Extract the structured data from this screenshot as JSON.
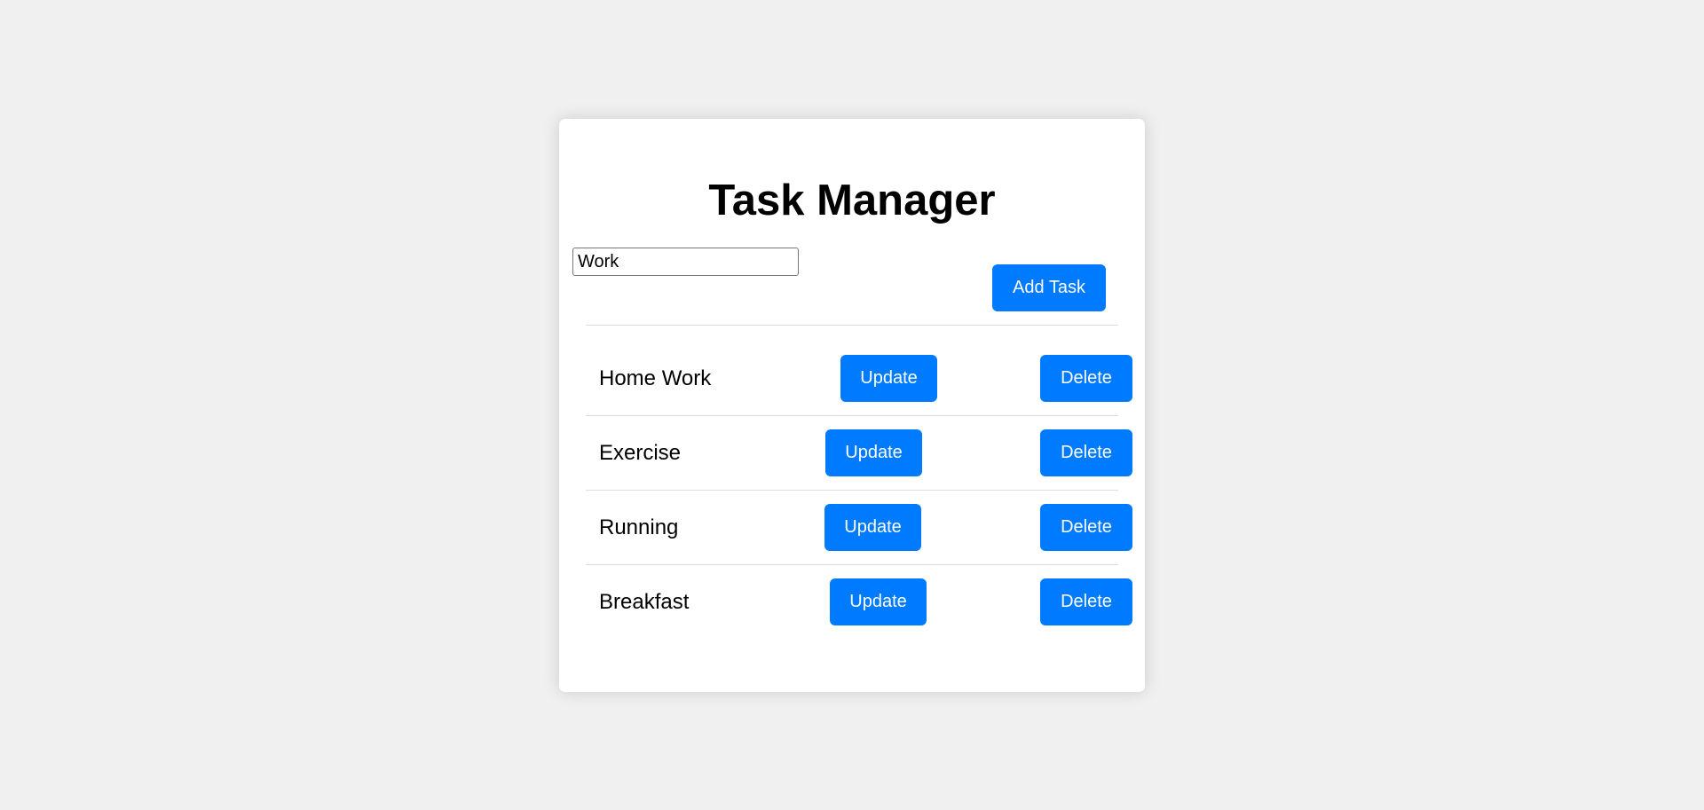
{
  "app": {
    "title": "Task Manager"
  },
  "add_form": {
    "input_value": "Work",
    "add_label": "Add Task"
  },
  "tasks": [
    {
      "label": "Home Work",
      "update_label": "Update",
      "delete_label": "Delete"
    },
    {
      "label": "Exercise",
      "update_label": "Update",
      "delete_label": "Delete"
    },
    {
      "label": "Running",
      "update_label": "Update",
      "delete_label": "Delete"
    },
    {
      "label": "Breakfast",
      "update_label": "Update",
      "delete_label": "Delete"
    }
  ],
  "colors": {
    "background": "#f0f0f0",
    "card": "#ffffff",
    "accent": "#007bff",
    "divider": "#dddddd"
  }
}
